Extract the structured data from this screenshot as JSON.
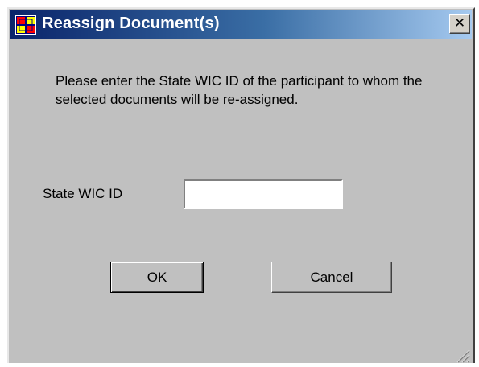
{
  "window": {
    "title": "Reassign Document(s)",
    "close_glyph": "✕",
    "app_icon": "app-icon",
    "colors": {
      "titlebar_start": "#0a246a",
      "titlebar_end": "#a6caf0",
      "dialog_background": "#c0c0c0"
    }
  },
  "message": "Please enter the State WIC ID of the participant to whom the selected documents will be re-assigned.",
  "form": {
    "state_wic_id_label": "State WIC ID",
    "state_wic_id_value": ""
  },
  "buttons": {
    "ok_label": "OK",
    "cancel_label": "Cancel"
  }
}
